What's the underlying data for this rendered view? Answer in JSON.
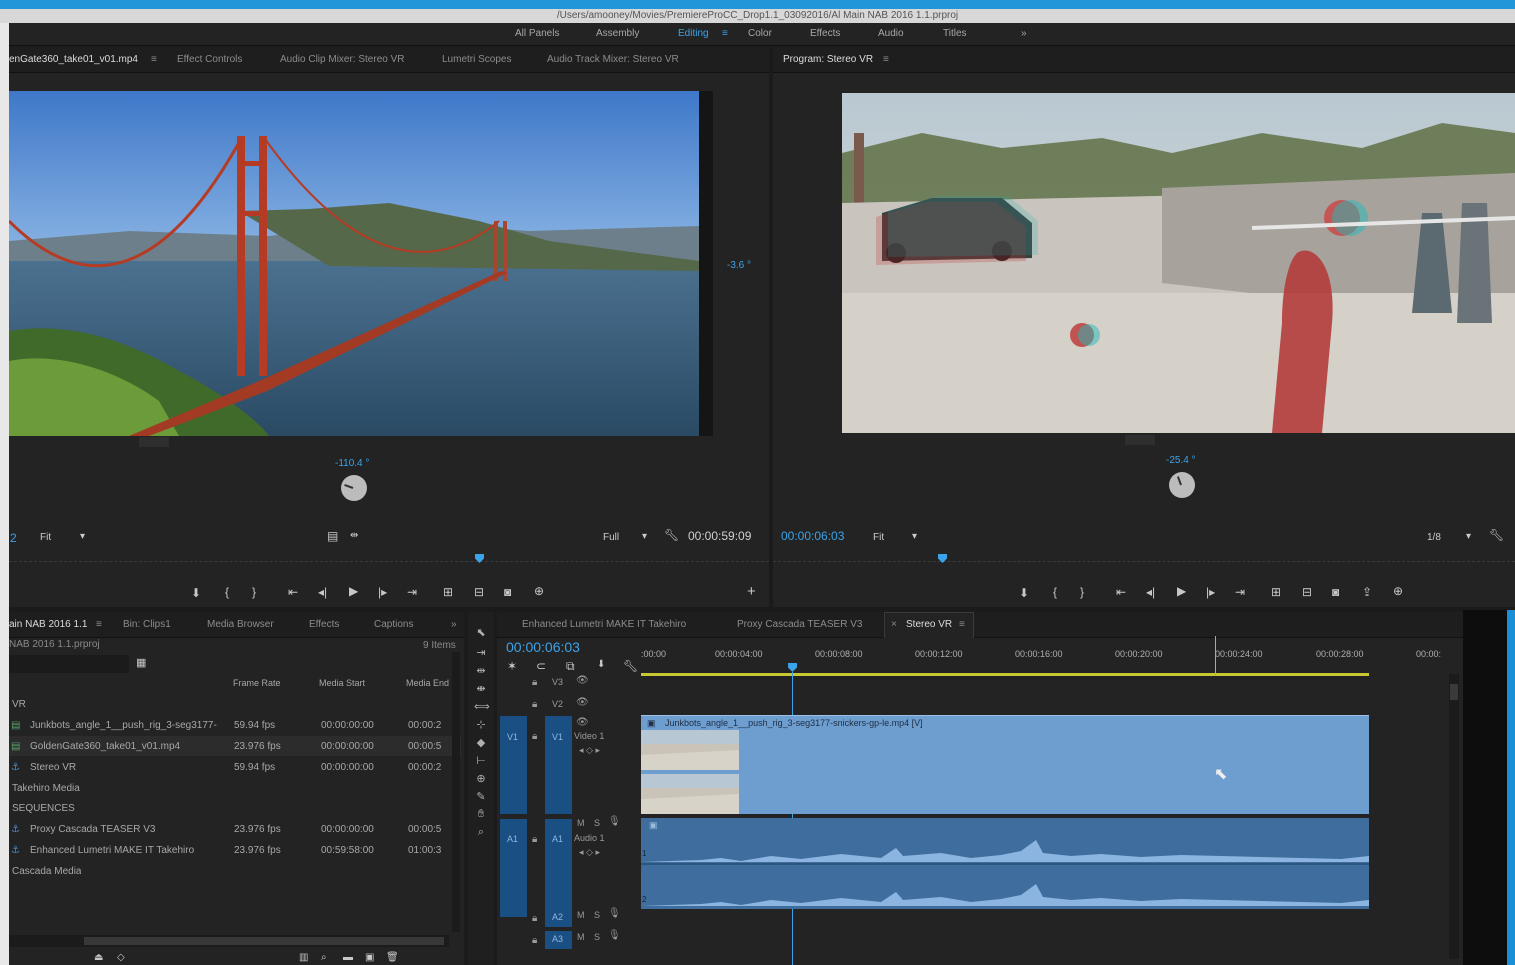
{
  "window": {
    "path": "/Users/amooney/Movies/PremiereProCC_Drop1.1_03092016/Al Main NAB 2016 1.1.prproj"
  },
  "workspaces": {
    "items": [
      "All Panels",
      "Assembly",
      "Editing",
      "Color",
      "Effects",
      "Audio",
      "Titles"
    ],
    "active": "Editing",
    "overflow": "»"
  },
  "source": {
    "tabs": [
      "enGate360_take01_v01.mp4",
      "Effect Controls",
      "Audio Clip Mixer: Stereo VR",
      "Lumetri Scopes",
      "Audio Track Mixer: Stereo VR"
    ],
    "tab_menu": "≡",
    "rotation_right": "-3.6 °",
    "rotation_bottom": "-110.4 °",
    "timecode_left": "2",
    "fit": "Fit",
    "quality": "Full",
    "timecode": "00:00:59:09",
    "add": "+"
  },
  "program": {
    "title": "Program: Stereo VR",
    "tab_menu": "≡",
    "rotation_bottom": "-25.4 °",
    "timecode": "00:00:06:03",
    "fit": "Fit",
    "resolution": "1/8"
  },
  "project": {
    "tabs": [
      "ain NAB 2016 1.1",
      "Bin: Clips1",
      "Media Browser",
      "Effects",
      "Captions"
    ],
    "tab_menu": "≡",
    "overflow": "»",
    "file": "NAB 2016 1.1.prproj",
    "count": "9 Items",
    "columns": [
      "Frame Rate",
      "Media Start",
      "Media End"
    ],
    "rows": [
      {
        "name": "VR",
        "rate": "",
        "start": "",
        "end": "",
        "icon": "none"
      },
      {
        "name": "Junkbots_angle_1__push_rig_3-seg3177-",
        "rate": "59.94 fps",
        "start": "00:00:00:00",
        "end": "00:00:2",
        "icon": "clip"
      },
      {
        "name": "GoldenGate360_take01_v01.mp4",
        "rate": "23.976 fps",
        "start": "00:00:00:00",
        "end": "00:00:5",
        "icon": "clip"
      },
      {
        "name": "Stereo VR",
        "rate": "59.94 fps",
        "start": "00:00:00:00",
        "end": "00:00:2",
        "icon": "sequence"
      },
      {
        "name": "Takehiro Media",
        "rate": "",
        "start": "",
        "end": "",
        "icon": "none"
      },
      {
        "name": "SEQUENCES",
        "rate": "",
        "start": "",
        "end": "",
        "icon": "none"
      },
      {
        "name": "Proxy Cascada TEASER V3",
        "rate": "23.976 fps",
        "start": "00:00:00:00",
        "end": "00:00:5",
        "icon": "sequence"
      },
      {
        "name": "Enhanced Lumetri MAKE IT Takehiro",
        "rate": "23.976 fps",
        "start": "00:59:58:00",
        "end": "01:00:3",
        "icon": "sequence"
      },
      {
        "name": "Cascada Media",
        "rate": "",
        "start": "",
        "end": "",
        "icon": "none"
      }
    ]
  },
  "timeline": {
    "tabs": [
      "Enhanced Lumetri MAKE IT Takehiro",
      "Proxy Cascada TEASER V3",
      "Stereo VR"
    ],
    "active_tab": "Stereo VR",
    "close": "×",
    "tab_menu": "≡",
    "timecode": "00:00:06:03",
    "ruler": [
      ":00:00",
      "00:00:04:00",
      "00:00:08:00",
      "00:00:12:00",
      "00:00:16:00",
      "00:00:20:00",
      "00:00:24:00",
      "00:00:28:00",
      "00:00:"
    ],
    "tracks": {
      "v3": "V3",
      "v2": "V2",
      "v1_src": "V1",
      "v1": "V1",
      "v1_name": "Video 1",
      "a1_src": "A1",
      "a1": "A1",
      "a1_name": "Audio 1",
      "a2": "A2",
      "a3": "A3",
      "mute": "M",
      "solo": "S"
    },
    "video_clip": "Junkbots_angle_1__push_rig_3-seg3177-snickers-gp-le.mp4 [V]",
    "audio_ch1": "1",
    "audio_ch2": "2"
  },
  "colors": {
    "accent": "#3ba3ea",
    "clip_video": "#6e9dcf",
    "clip_audio": "#3f6e9e",
    "track_header": "#1a4f83"
  }
}
